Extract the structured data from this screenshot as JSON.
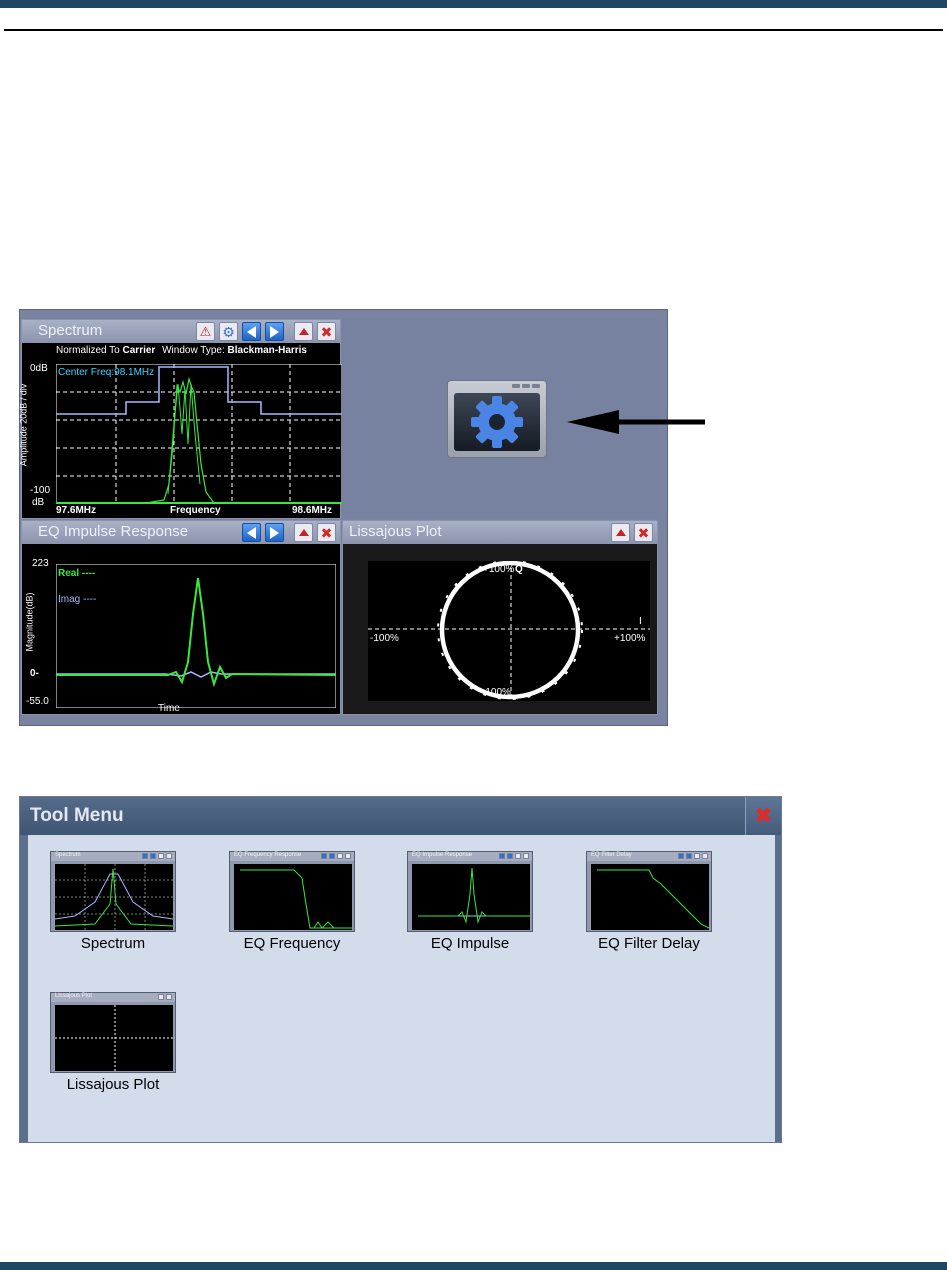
{
  "spectrum": {
    "title": "Spectrum",
    "normalized_prefix": "Normalized To",
    "normalized_value": "Carrier",
    "window_prefix": "Window Type:",
    "window_value": "Blackman-Harris",
    "center_freq": "Center Freq:98.1MHz",
    "y_top": "0dB",
    "y_bottom_1": "-100",
    "y_bottom_2": "dB",
    "y_axis_label": "Amplitude 20dB / div",
    "x_left": "97.6MHz",
    "x_center": "Frequency",
    "x_right": "98.6MHz"
  },
  "eq_impulse": {
    "title": "EQ Impulse Response",
    "y_top": "223",
    "y_zero": "0-",
    "y_bottom": "-55.0",
    "y_axis_label": "Magnitude(dB)",
    "x_label": "Time",
    "legend_real": "Real ----",
    "legend_imag": "Imag ----"
  },
  "lissajous": {
    "title": "Lissajous Plot",
    "top_label": "+100%",
    "q_label": "Q",
    "i_label": "I",
    "left_label": "-100%",
    "right_label": "+100%",
    "bottom_label": "-100%"
  },
  "tool_menu": {
    "title": "Tool Menu",
    "tools": [
      {
        "label": "Spectrum",
        "thumb_title": "Spectrum"
      },
      {
        "label": "EQ Frequency",
        "thumb_title": "EQ Frequency Response"
      },
      {
        "label": "EQ Impulse",
        "thumb_title": "EQ Impulse Response"
      },
      {
        "label": "EQ Filter Delay",
        "thumb_title": "EQ Filter Delay"
      },
      {
        "label": "Lissajous Plot",
        "thumb_title": "Lissajous Plot"
      }
    ]
  },
  "colors": {
    "trace_green": "#39e83a",
    "trace_blue": "#a7b7ff",
    "header_navy": "#1f4662",
    "cyan_label": "#39d7ff"
  }
}
